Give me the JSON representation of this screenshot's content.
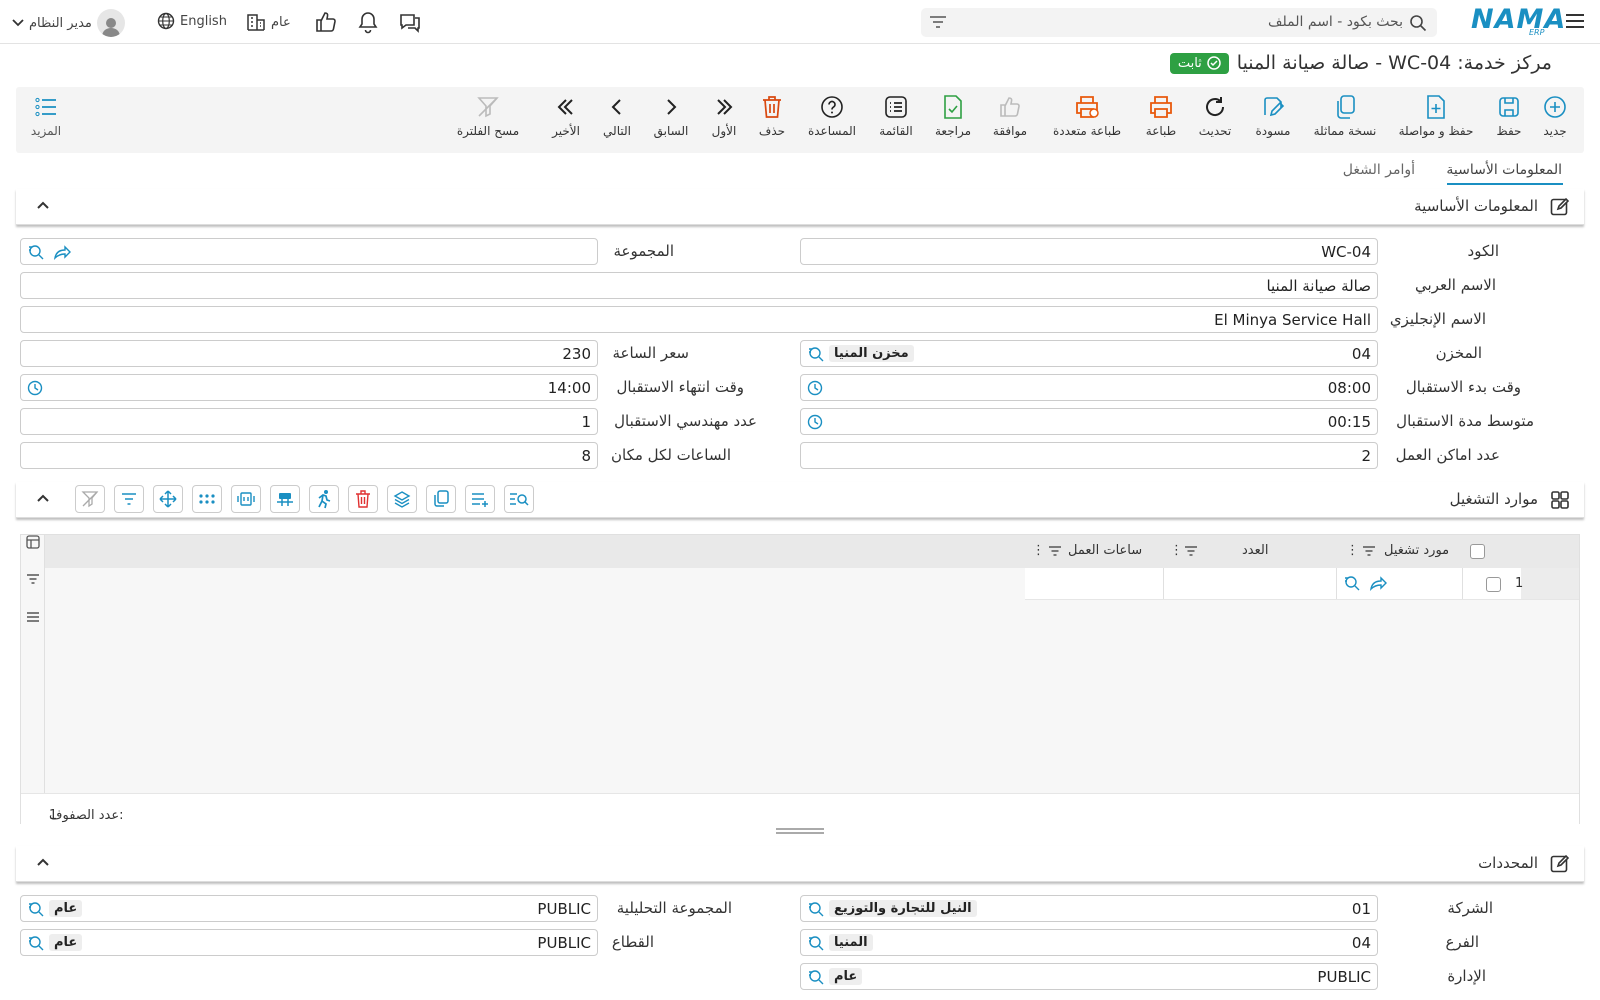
{
  "header": {
    "logo_text": "NAMA",
    "logo_sub": "ERP",
    "search_placeholder": "بحث بكود - اسم الملف",
    "user_name": "مدير النظام",
    "language": "English",
    "scope": "عام"
  },
  "title": {
    "text": "مركز خدمة: WC-04 - صالة صيانة المنيا",
    "status": "ثابت",
    "status_color": "#2ea043"
  },
  "toolbar": {
    "buttons": [
      {
        "label": "جديد",
        "icon": "plus-circle-icon",
        "color": "#1a8fc2"
      },
      {
        "label": "حفظ",
        "icon": "save-icon",
        "color": "#1a8fc2"
      },
      {
        "label": "حفظ و مواصلة",
        "icon": "file-plus-icon",
        "color": "#1a8fc2"
      },
      {
        "label": "نسخة مماثلة",
        "icon": "copy-icon",
        "color": "#1a8fc2"
      },
      {
        "label": "مسودة",
        "icon": "edit-icon",
        "color": "#1a8fc2"
      },
      {
        "label": "تحديث",
        "icon": "refresh-icon",
        "color": "#222"
      },
      {
        "label": "طباعة",
        "icon": "print-icon",
        "color": "#e8590c"
      },
      {
        "label": "طباعة متعددة",
        "icon": "multi-print-icon",
        "color": "#e8590c"
      },
      {
        "label": "موافقة",
        "icon": "thumbs-up-icon",
        "color": "#bbb"
      },
      {
        "label": "مراجعة",
        "icon": "file-check-icon",
        "color": "#2ea043"
      },
      {
        "label": "القائمة",
        "icon": "list-icon",
        "color": "#222"
      },
      {
        "label": "المساعدة",
        "icon": "help-icon",
        "color": "#222"
      },
      {
        "label": "حذف",
        "icon": "trash-icon",
        "color": "#d9480f"
      },
      {
        "label": "الأول",
        "icon": "first-icon",
        "color": "#222"
      },
      {
        "label": "السابق",
        "icon": "prev-icon",
        "color": "#222"
      },
      {
        "label": "التالي",
        "icon": "next-icon",
        "color": "#222"
      },
      {
        "label": "الأخير",
        "icon": "last-icon",
        "color": "#222"
      },
      {
        "label": "مسح الفلترة",
        "icon": "clear-filter-icon",
        "color": "#bbb"
      }
    ],
    "more_label": "المزيد"
  },
  "tabs": [
    {
      "label": "المعلومات الأساسية",
      "active": true
    },
    {
      "label": "أوامر الشغل",
      "active": false
    }
  ],
  "basic_section": {
    "title": "المعلومات الأساسية",
    "fields": {
      "code": {
        "label": "الكود",
        "value": "WC-04"
      },
      "group": {
        "label": "المجموعة",
        "value": ""
      },
      "arabic_name": {
        "label": "الاسم العربي",
        "value": "صالة صيانة المنيا"
      },
      "english_name": {
        "label": "الاسم الإنجليزي",
        "value": "El Minya Service Hall"
      },
      "warehouse": {
        "label": "المخزن",
        "value": "04",
        "tag": "مخزن المنيا"
      },
      "hour_price": {
        "label": "سعر الساعة",
        "value": "230"
      },
      "reception_start": {
        "label": "وقت بدء الاستقبال",
        "value": "08:00"
      },
      "reception_end": {
        "label": "وقت انتهاء الاستقبال",
        "value": "14:00"
      },
      "avg_reception": {
        "label": "متوسط مدة الاستقبال",
        "value": "00:15"
      },
      "reception_engineers": {
        "label": "عدد مهندسي الاستقبال",
        "value": "1"
      },
      "work_places": {
        "label": "عدد اماكن العمل",
        "value": "2"
      },
      "hours_per_place": {
        "label": "الساعات لكل مكان",
        "value": "8"
      }
    }
  },
  "resources_section": {
    "title": "موارد التشغيل",
    "columns": [
      "مورد تشغيل",
      "العدد",
      "ساعات العمل"
    ],
    "rows": [
      {
        "num": "1",
        "resource": "",
        "count": "",
        "hours": ""
      }
    ],
    "row_count_label": "عدد الصفوف:",
    "row_count": "1"
  },
  "dimensions_section": {
    "title": "المحددات",
    "fields": {
      "company": {
        "label": "الشركة",
        "value": "01",
        "tag": "النيل للتجارة والتوزيع"
      },
      "analytic_group": {
        "label": "المجموعة التحليلية",
        "value": "PUBLIC",
        "tag": "عام"
      },
      "branch": {
        "label": "الفرع",
        "value": "04",
        "tag": "المنيا"
      },
      "sector": {
        "label": "القطاع",
        "value": "PUBLIC",
        "tag": "عام"
      },
      "department": {
        "label": "الإدارة",
        "value": "PUBLIC",
        "tag": "عام"
      }
    }
  }
}
